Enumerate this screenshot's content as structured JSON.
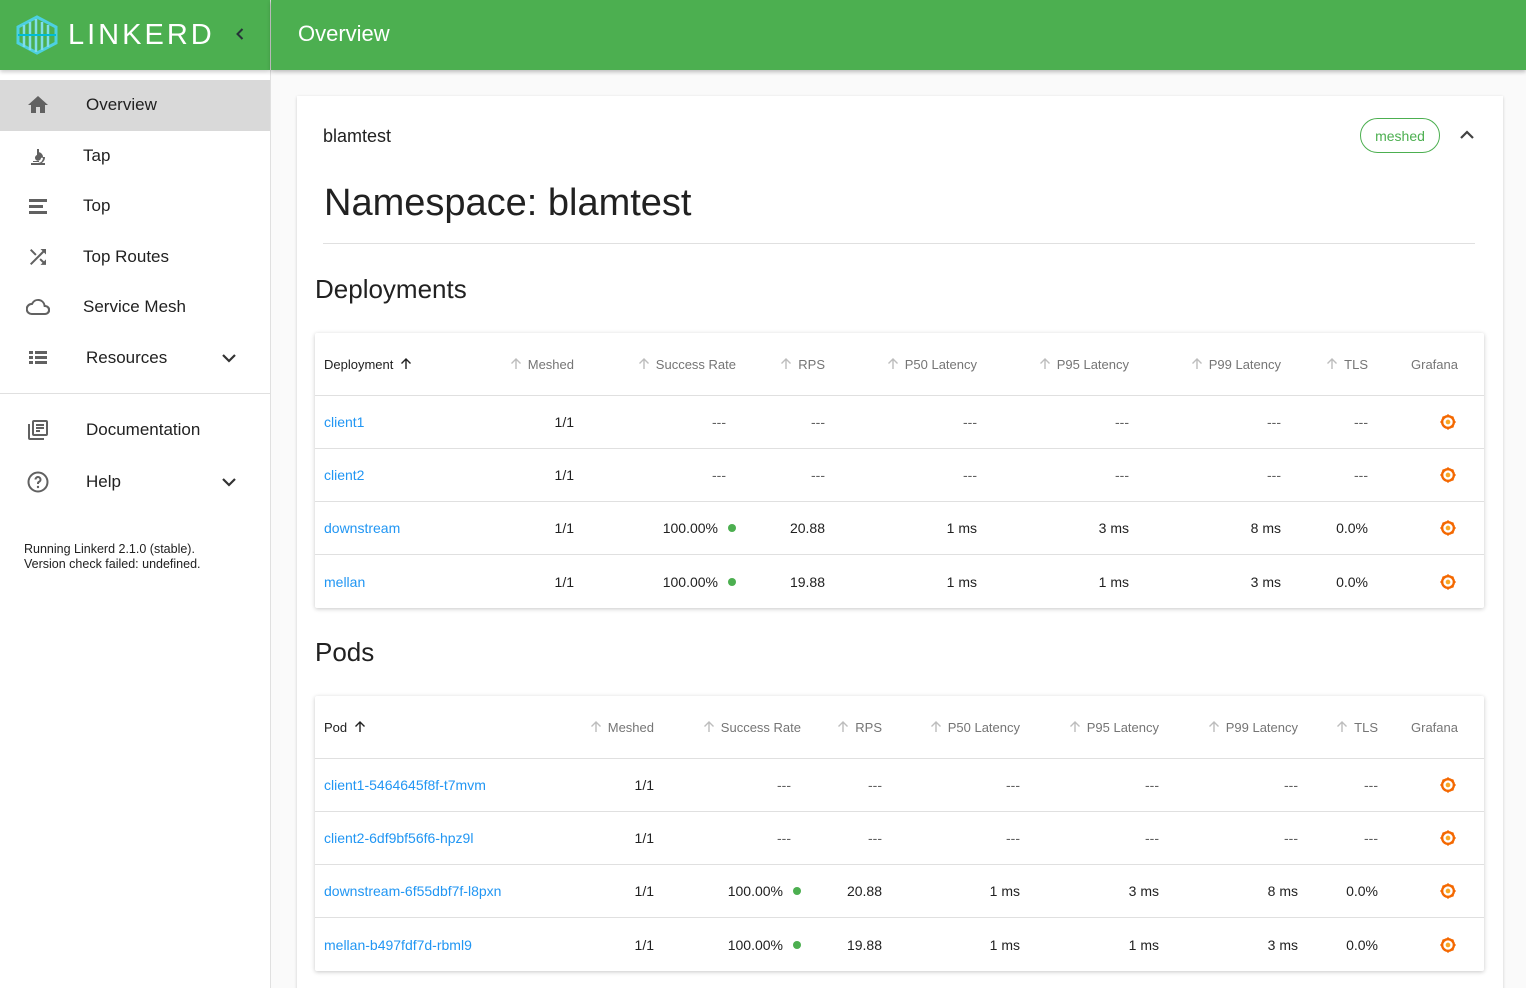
{
  "brand": {
    "name": "LINKERD"
  },
  "sidebar": {
    "items": [
      {
        "label": "Overview",
        "icon": "home-icon"
      },
      {
        "label": "Tap",
        "icon": "microscope-icon"
      },
      {
        "label": "Top",
        "icon": "list-icon"
      },
      {
        "label": "Top Routes",
        "icon": "shuffle-icon"
      },
      {
        "label": "Service Mesh",
        "icon": "cloud-icon"
      },
      {
        "label": "Resources",
        "icon": "table-icon"
      }
    ],
    "secondary": [
      {
        "label": "Documentation",
        "icon": "library-books-icon"
      },
      {
        "label": "Help",
        "icon": "help-circle-icon"
      }
    ],
    "version_line1": "Running Linkerd 2.1.0 (stable).",
    "version_line2": "Version check failed: undefined."
  },
  "topbar": {
    "title": "Overview"
  },
  "card": {
    "head": "blamtest",
    "badge": "meshed",
    "namespace_title": "Namespace: blamtest"
  },
  "deployments": {
    "title": "Deployments",
    "columns": [
      "Deployment",
      "Meshed",
      "Success Rate",
      "RPS",
      "P50 Latency",
      "P95 Latency",
      "P99 Latency",
      "TLS",
      "Grafana"
    ],
    "rows": [
      {
        "name": "client1",
        "meshed": "1/1",
        "sr": "---",
        "rps": "---",
        "p50": "---",
        "p95": "---",
        "p99": "---",
        "tls": "---",
        "ok": false
      },
      {
        "name": "client2",
        "meshed": "1/1",
        "sr": "---",
        "rps": "---",
        "p50": "---",
        "p95": "---",
        "p99": "---",
        "tls": "---",
        "ok": false
      },
      {
        "name": "downstream",
        "meshed": "1/1",
        "sr": "100.00%",
        "rps": "20.88",
        "p50": "1 ms",
        "p95": "3 ms",
        "p99": "8 ms",
        "tls": "0.0%",
        "ok": true
      },
      {
        "name": "mellan",
        "meshed": "1/1",
        "sr": "100.00%",
        "rps": "19.88",
        "p50": "1 ms",
        "p95": "1 ms",
        "p99": "3 ms",
        "tls": "0.0%",
        "ok": true
      }
    ]
  },
  "pods": {
    "title": "Pods",
    "columns": [
      "Pod",
      "Meshed",
      "Success Rate",
      "RPS",
      "P50 Latency",
      "P95 Latency",
      "P99 Latency",
      "TLS",
      "Grafana"
    ],
    "rows": [
      {
        "name": "client1-5464645f8f-t7mvm",
        "meshed": "1/1",
        "sr": "---",
        "rps": "---",
        "p50": "---",
        "p95": "---",
        "p99": "---",
        "tls": "---",
        "ok": false
      },
      {
        "name": "client2-6df9bf56f6-hpz9l",
        "meshed": "1/1",
        "sr": "---",
        "rps": "---",
        "p50": "---",
        "p95": "---",
        "p99": "---",
        "tls": "---",
        "ok": false
      },
      {
        "name": "downstream-6f55dbf7f-l8pxn",
        "meshed": "1/1",
        "sr": "100.00%",
        "rps": "20.88",
        "p50": "1 ms",
        "p95": "3 ms",
        "p99": "8 ms",
        "tls": "0.0%",
        "ok": true
      },
      {
        "name": "mellan-b497fdf7d-rbml9",
        "meshed": "1/1",
        "sr": "100.00%",
        "rps": "19.88",
        "p50": "1 ms",
        "p95": "1 ms",
        "p99": "3 ms",
        "tls": "0.0%",
        "ok": true
      }
    ]
  },
  "colors": {
    "accent": "#4caf50",
    "link": "#2196f3",
    "grafana": "#f46800"
  }
}
